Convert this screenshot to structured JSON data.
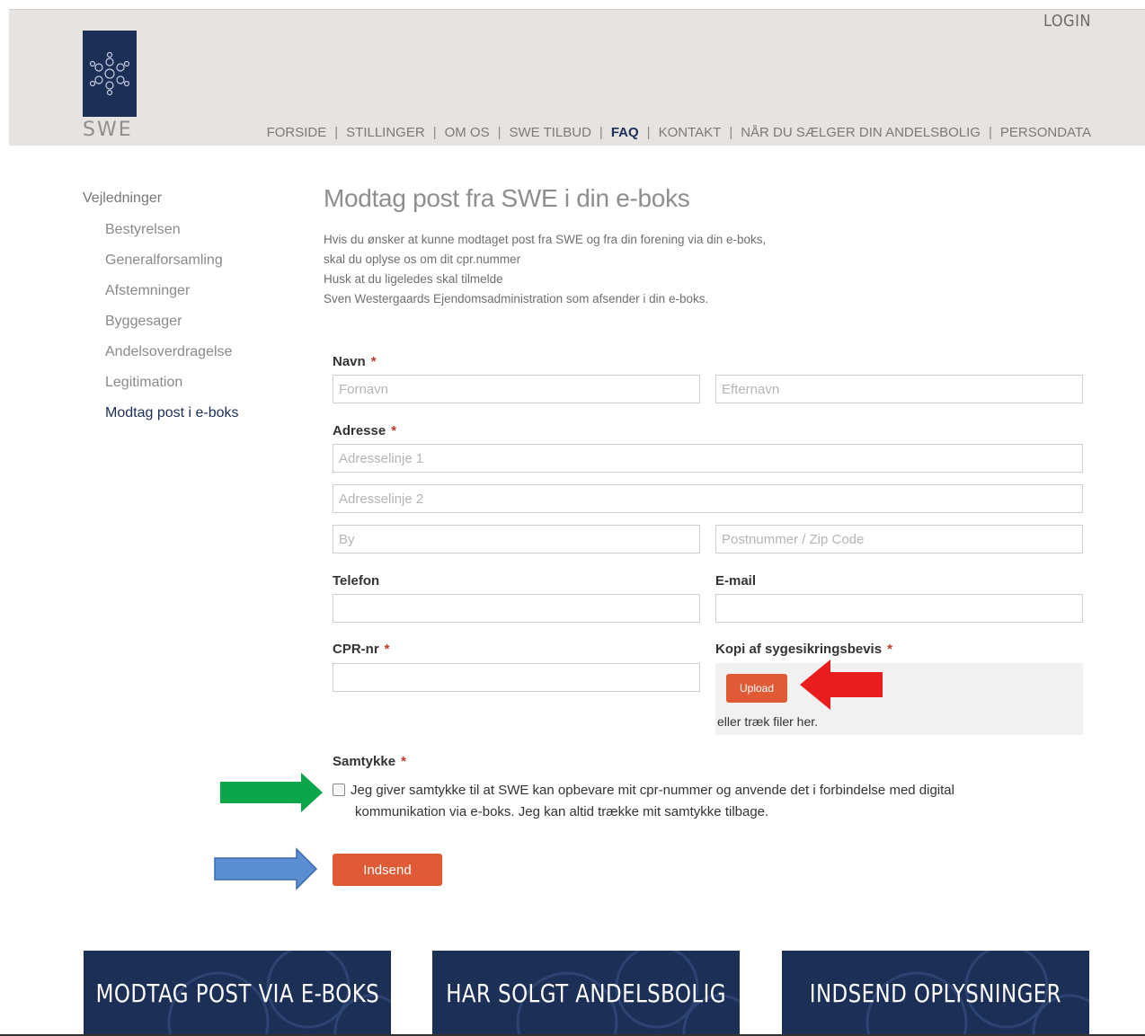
{
  "header": {
    "logo_text": "SWE",
    "login": "LOGIN",
    "nav": [
      {
        "label": "FORSIDE",
        "active": false
      },
      {
        "label": "STILLINGER",
        "active": false
      },
      {
        "label": "OM OS",
        "active": false
      },
      {
        "label": "SWE TILBUD",
        "active": false
      },
      {
        "label": "FAQ",
        "active": true
      },
      {
        "label": "KONTAKT",
        "active": false
      },
      {
        "label": "NÅR DU SÆLGER DIN ANDELSBOLIG",
        "active": false
      },
      {
        "label": "PERSONDATA",
        "active": false
      }
    ],
    "separator": "|"
  },
  "sidebar": {
    "head": "Vejledninger",
    "items": [
      {
        "label": "Bestyrelsen"
      },
      {
        "label": "Generalforsamling"
      },
      {
        "label": "Afstemninger"
      },
      {
        "label": "Byggesager"
      },
      {
        "label": "Andelsoverdragelse"
      },
      {
        "label": "Legitimation"
      },
      {
        "label": "Modtag post i e-boks"
      }
    ]
  },
  "main": {
    "title": "Modtag post fra SWE i din e-boks",
    "intro": [
      "Hvis du ønsker at kunne modtaget post fra SWE og fra din forening via din e-boks,",
      "skal du oplyse os om dit cpr.nummer",
      "Husk at du ligeledes skal tilmelde",
      "Sven Westergaards Ejendomsadministration som afsender i din e-boks."
    ]
  },
  "form": {
    "required_mark": "*",
    "name_label": "Navn",
    "first_name_placeholder": "Fornavn",
    "last_name_placeholder": "Efternavn",
    "address_label": "Adresse",
    "address1_placeholder": "Adresselinje 1",
    "address2_placeholder": "Adresselinje 2",
    "city_placeholder": "By",
    "zip_placeholder": "Postnummer / Zip Code",
    "phone_label": "Telefon",
    "email_label": "E-mail",
    "cpr_label": "CPR-nr",
    "insurance_label": "Kopi af sygesikringsbevis",
    "upload_button": "Upload",
    "upload_hint": "eller træk filer her.",
    "consent_label": "Samtykke",
    "consent_line1": "Jeg giver samtykke til at SWE kan opbevare mit cpr-nummer og anvende det i forbindelse med digital",
    "consent_line2": "kommunikation via e-boks. Jeg kan altid trække mit samtykke tilbage.",
    "submit_button": "Indsend"
  },
  "banners": [
    {
      "label": "MODTAG POST VIA E-BOKS"
    },
    {
      "label": "HAR SOLGT ANDELSBOLIG"
    },
    {
      "label": "INDSEND OPLYSNINGER"
    }
  ],
  "colors": {
    "navy": "#1c2f57",
    "orange": "#e05a35",
    "arrow_red": "#e81e1e",
    "arrow_green": "#0aa64a",
    "arrow_blue": "#5b8ed1"
  }
}
